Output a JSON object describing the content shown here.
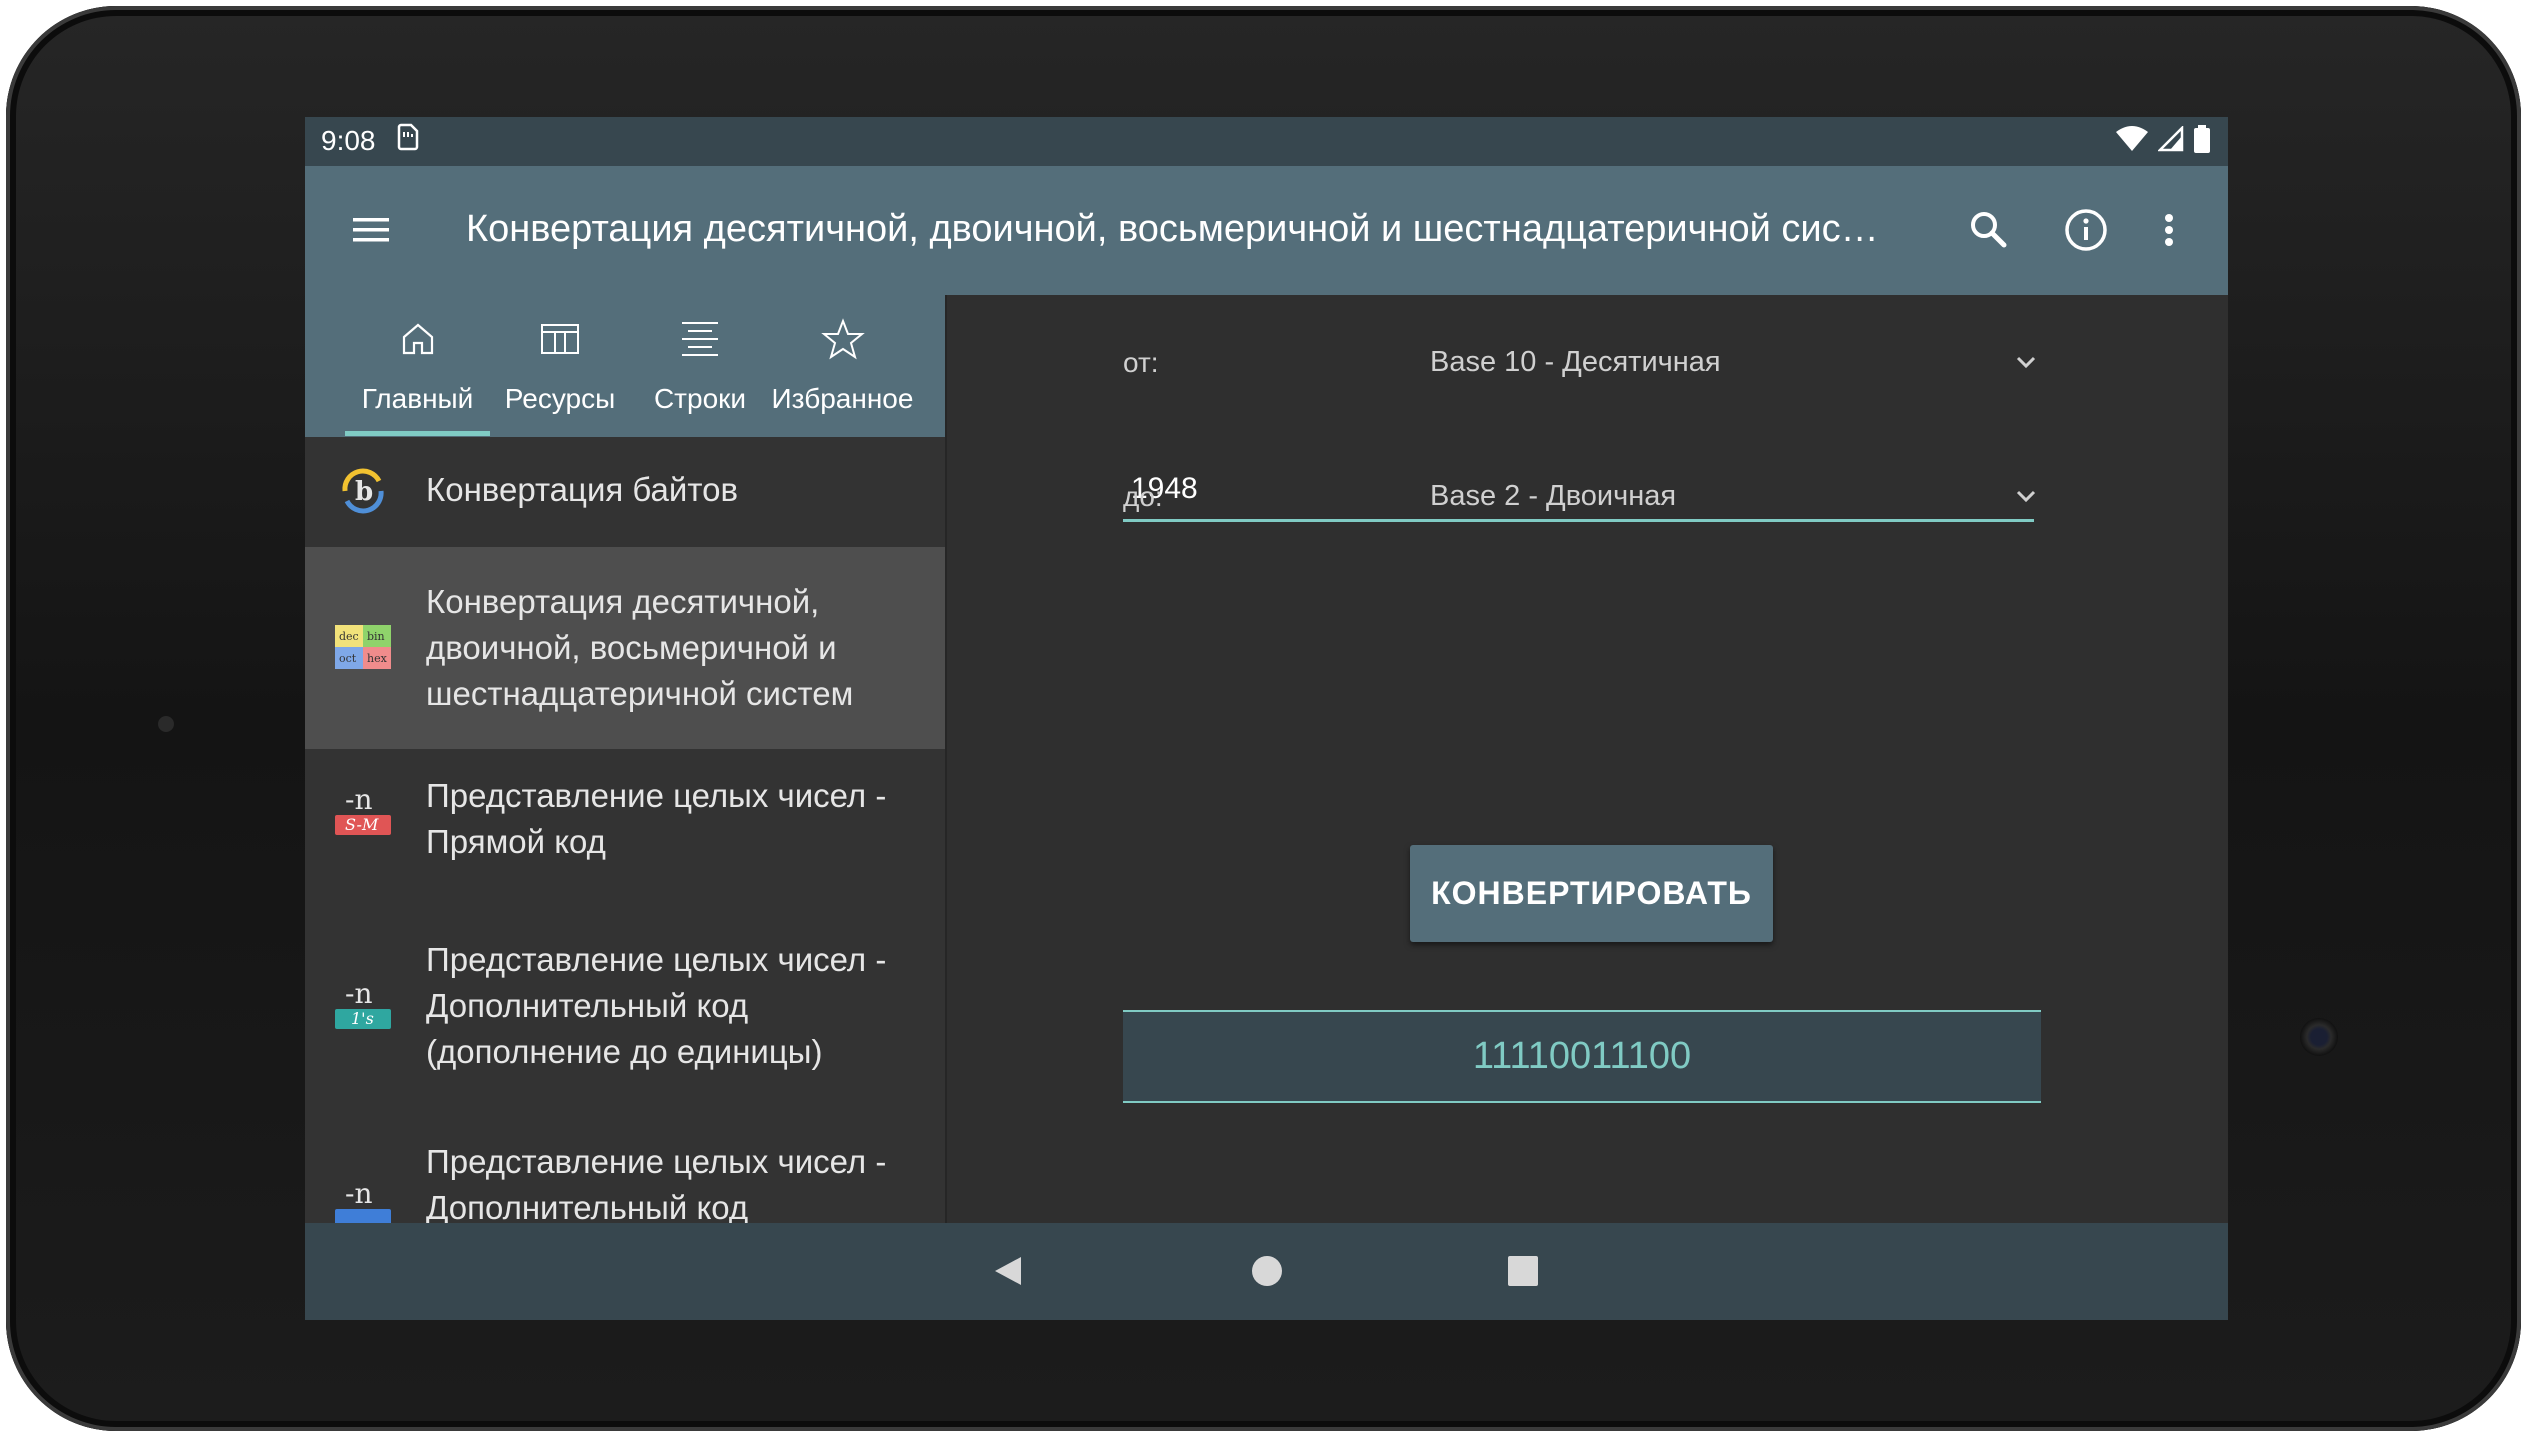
{
  "status_bar": {
    "time": "9:08"
  },
  "app_bar": {
    "title": "Конвертация десятичной, двоичной, восьмеричной и шестнадцатеричной систем"
  },
  "tabs": [
    {
      "label": "Главный",
      "icon": "home-icon",
      "selected": true
    },
    {
      "label": "Ресурсы",
      "icon": "table-icon",
      "selected": false
    },
    {
      "label": "Строки",
      "icon": "align-center-icon",
      "selected": false
    },
    {
      "label": "Избранное",
      "icon": "star-outline-icon",
      "selected": false
    }
  ],
  "list_items": [
    {
      "label": "Конвертация байтов",
      "icon": "byte-convert-icon",
      "selected": false
    },
    {
      "label": "Конвертация десятичной, двоичной, восьмеричной и шестнадцатеричной систем",
      "icon": "dec-bin-oct-hex-icon",
      "selected": true,
      "icon_text": [
        "dec",
        "bin",
        "oct",
        "hex"
      ]
    },
    {
      "label": "Представление целых чисел - Прямой код",
      "icon": "sign-magnitude-icon",
      "selected": false,
      "icon_text": [
        "-n",
        "S-M"
      ]
    },
    {
      "label": "Представление целых чисел - Дополнительный код (дополнение до единицы)",
      "icon": "ones-complement-icon",
      "selected": false,
      "icon_text": [
        "-n",
        "1's"
      ]
    },
    {
      "label": "Представление целых чисел - Дополнительный код",
      "icon": "twos-complement-icon",
      "selected": false,
      "icon_text": [
        "-n"
      ]
    }
  ],
  "converter": {
    "from_label": "от:",
    "from_value": "Base 10 - Десятичная",
    "input_value": "1948",
    "to_label": "до:",
    "to_value": "Base 2 - Двоичная",
    "button_label": "КОНВЕРТИРОВАТЬ",
    "result": "11110011100"
  },
  "colors": {
    "app_bar": "#546e7a",
    "status_bar": "#37474f",
    "accent": "#80cbc4",
    "background": "#2f2f2f"
  }
}
